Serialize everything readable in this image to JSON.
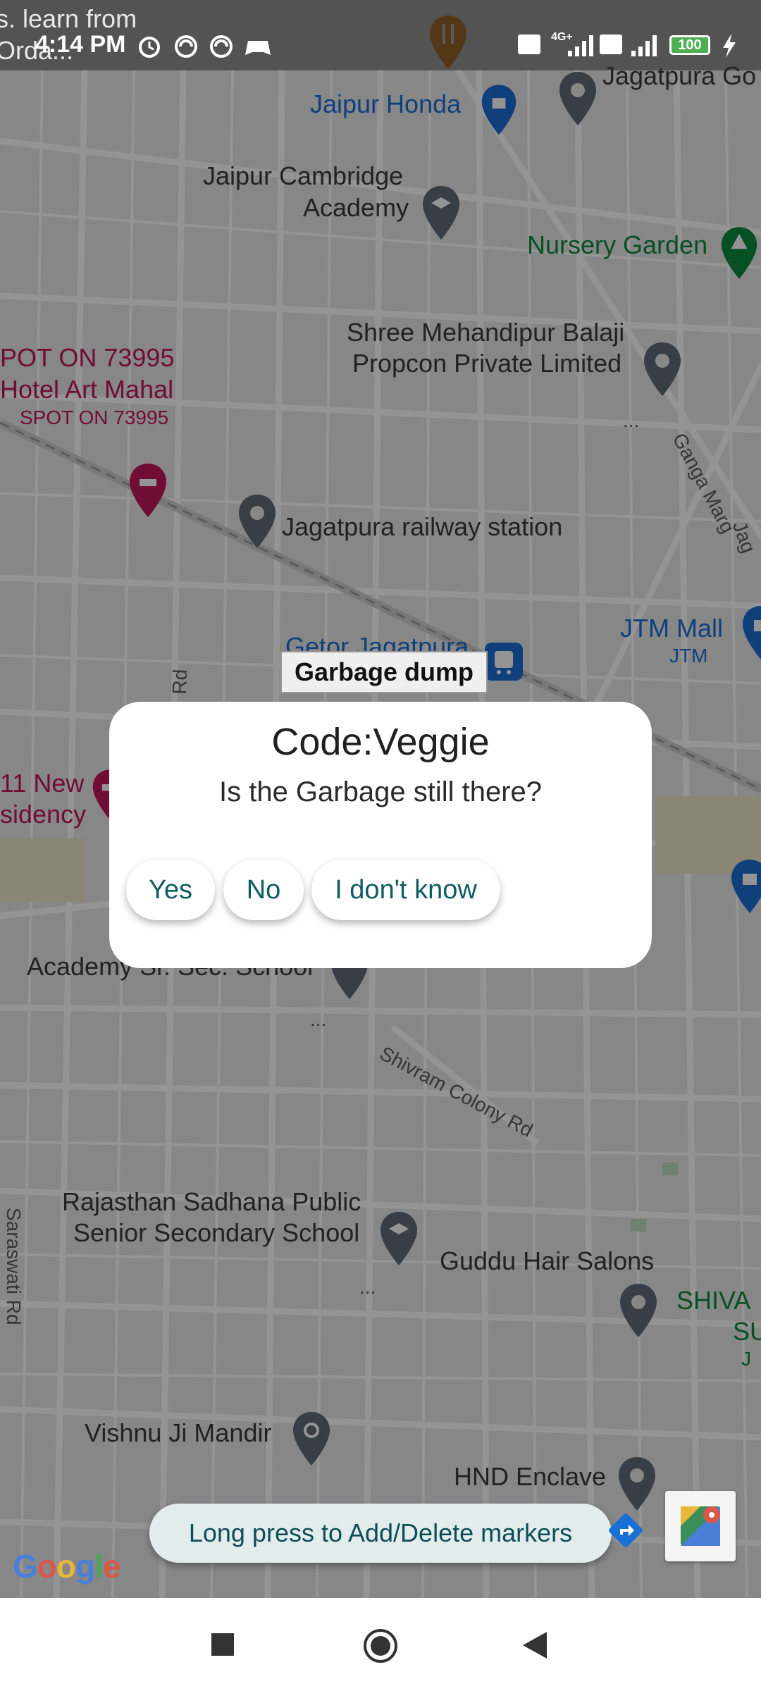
{
  "status_bar": {
    "time": "4:14 PM",
    "background_text": [
      "s. learn from",
      "Orda..."
    ],
    "battery": "100",
    "network": "4G+"
  },
  "map": {
    "labels": {
      "jaipur_honda": "Jaipur Honda",
      "jagatpura_go": "Jagatpura Go",
      "cambridge": [
        "Jaipur Cambridge",
        "Academy"
      ],
      "nursery": "Nursery Garden",
      "mehandipur": [
        "Shree Mehandipur Balaji",
        "Propcon Private Limited"
      ],
      "spot_on_top": "POT ON 73995",
      "hotel_art_mahal": "Hotel Art Mahal",
      "spot_on_sub": "SPOT ON 73995",
      "railway": "Jagatpura railway station",
      "ganga_marg": "Ganga Marg",
      "jag_edge": "Jag",
      "jtm_mall": "JTM Mall",
      "jtm_sub": "JTM",
      "getor": "Getor Jagatpura",
      "rd_vertical": "Rd",
      "new_residency": [
        "11 New",
        "sidency"
      ],
      "academy": "Academy Sr. Sec. School",
      "shivram": "Shivram Colony Rd",
      "rajasthan_school": [
        "Rajasthan Sadhana Public",
        "Senior Secondary School"
      ],
      "guddu": "Guddu Hair Salons",
      "saraswati": "Saraswati Rd",
      "shiva": [
        "SHIVA",
        "SU",
        "J"
      ],
      "vishnu": "Vishnu Ji Mandir",
      "hnd": "HND Enclave",
      "ellipsis": "..."
    },
    "marker_title": "Garbage dump",
    "colors": {
      "map_bg": "#e9e9ea",
      "road": "#ffffff",
      "poi_blue": "#1a6fd6",
      "poi_green": "#0c8a3d",
      "poi_red": "#c2185b"
    }
  },
  "dialog": {
    "title": "Code:Veggie",
    "message": "Is the Garbage still there?",
    "buttons": {
      "yes": "Yes",
      "no": "No",
      "unknown": "I don't know"
    },
    "accent": "#0e5c63"
  },
  "snackbar": {
    "text": "Long press to Add/Delete markers"
  },
  "google_logo": "Google",
  "nav_bar": {
    "icons": [
      "recents-square-icon",
      "home-circle-icon",
      "back-triangle-icon"
    ]
  }
}
